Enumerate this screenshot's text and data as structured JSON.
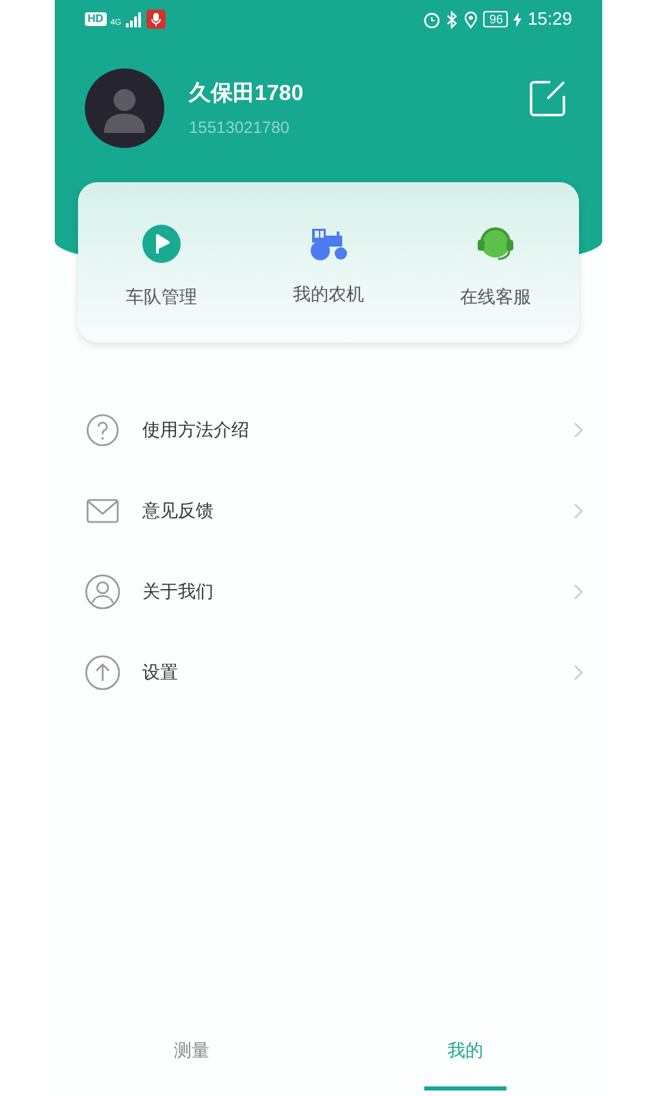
{
  "status_bar": {
    "hd": "HD",
    "network": "4G",
    "battery": "96",
    "time": "15:29"
  },
  "profile": {
    "name": "久保田1780",
    "phone": "15513021780"
  },
  "shortcuts": [
    {
      "kind": "fleet",
      "label": "车队管理"
    },
    {
      "kind": "tractor",
      "label": "我的农机"
    },
    {
      "kind": "service",
      "label": "在线客服"
    }
  ],
  "menu": [
    {
      "kind": "help",
      "label": "使用方法介绍"
    },
    {
      "kind": "mail",
      "label": "意见反馈"
    },
    {
      "kind": "user",
      "label": "关于我们"
    },
    {
      "kind": "up",
      "label": "设置"
    }
  ],
  "tabs": [
    {
      "label": "测量",
      "selected": false
    },
    {
      "label": "我的",
      "selected": true
    }
  ]
}
